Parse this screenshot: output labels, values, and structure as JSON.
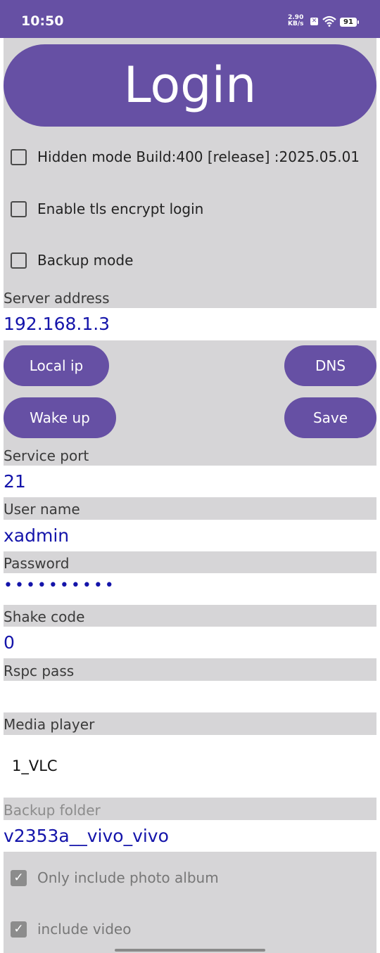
{
  "status_bar": {
    "time": "10:50",
    "net_speed_value": "2.90",
    "net_speed_unit": "KB/s",
    "battery": "91",
    "icons": [
      "x-notification-icon",
      "wifi-icon",
      "battery-icon"
    ]
  },
  "login": {
    "label": "Login"
  },
  "checkboxes": [
    {
      "label": "Hidden mode Build:400 [release] :2025.05.01",
      "checked": false
    },
    {
      "label": "Enable tls encrypt login",
      "checked": false
    },
    {
      "label": "Backup mode",
      "checked": false
    }
  ],
  "server": {
    "label": "Server address",
    "value": "192.168.1.3",
    "buttons": {
      "local_ip": "Local ip",
      "dns": "DNS",
      "wake_up": "Wake up",
      "save": "Save"
    }
  },
  "service_port": {
    "label": "Service port",
    "value": "21"
  },
  "user_name": {
    "label": "User name",
    "value": "xadmin"
  },
  "password": {
    "label": "Password",
    "value": "••••••••••"
  },
  "shake_code": {
    "label": "Shake code",
    "value": "0"
  },
  "rspc_pass": {
    "label": "Rspc pass",
    "value": ""
  },
  "media_player": {
    "label": "Media player",
    "value": "1_VLC"
  },
  "backup_folder": {
    "label": "Backup folder",
    "value": "v2353a__vivo_vivo"
  },
  "backup_options": [
    {
      "label": "Only include photo album",
      "checked": true
    },
    {
      "label": "include video",
      "checked": true
    }
  ],
  "colors": {
    "accent": "#6650a4",
    "panel": "#d6d5d7",
    "value_text": "#1414aa"
  }
}
